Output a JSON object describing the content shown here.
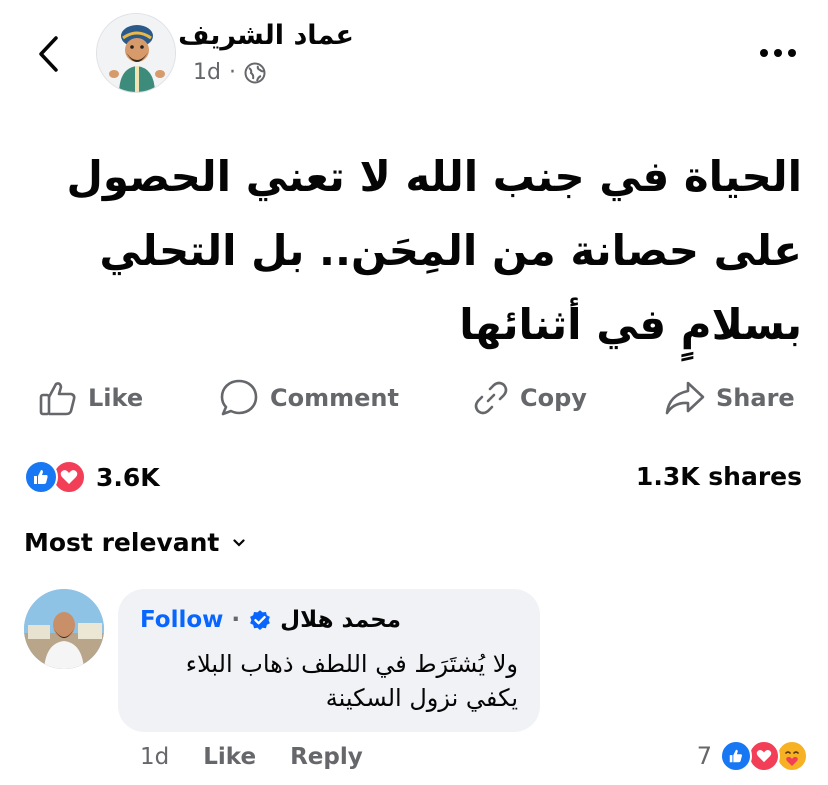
{
  "header": {
    "author_name": "عماد الشريف",
    "time": "1d",
    "separator": "·",
    "audience_icon": "globe-icon"
  },
  "post": {
    "text": "الحياة في جنب الله لا تعني الحصول على حصانة من المِحَن.. بل التحلي بسلامٍ في أثنائها"
  },
  "actions": {
    "like": "Like",
    "comment": "Comment",
    "copy": "Copy",
    "share": "Share"
  },
  "stats": {
    "reactions_count": "3.6K",
    "shares": "1.3K shares"
  },
  "comments_sort": {
    "label": "Most relevant"
  },
  "comment": {
    "follow_label": "Follow",
    "separator": "·",
    "author_name": "محمد هلال",
    "verified": true,
    "text": "ولا يُشتَرَط في اللطف ذهاب البلاء يكفي نزول السكينة",
    "time": "1d",
    "like_label": "Like",
    "reply_label": "Reply",
    "reactions_count": "7"
  },
  "colors": {
    "accent": "#0866ff",
    "like": "#1877f2",
    "love": "#f33e58",
    "care": "#f7b125",
    "muted": "#65676b",
    "bubble": "#f0f2f5"
  }
}
